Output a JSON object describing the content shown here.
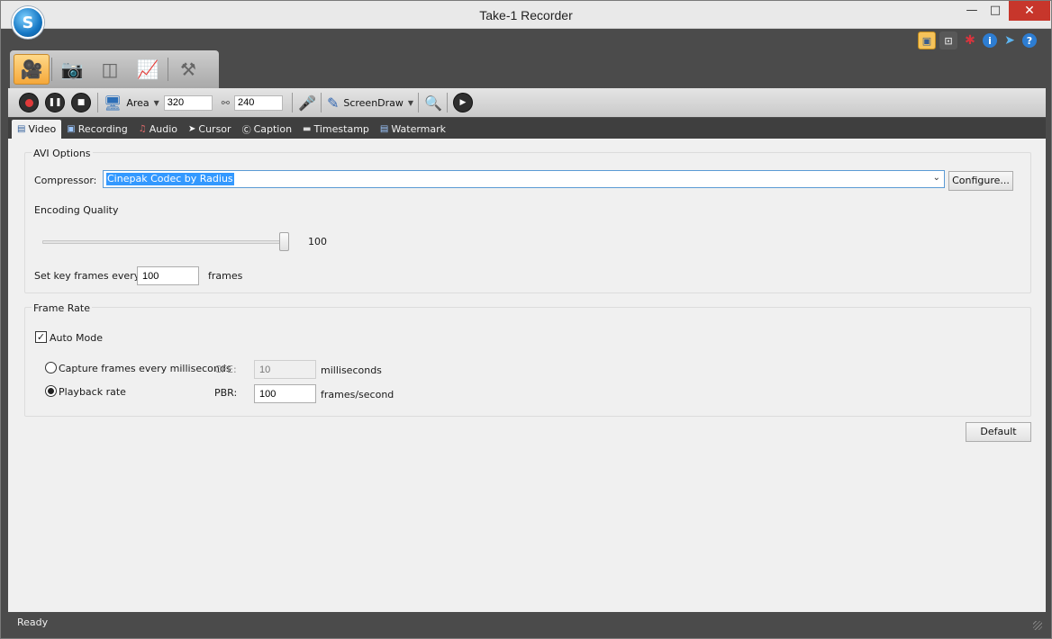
{
  "window": {
    "title": "Take-1 Recorder",
    "minimize_icon": "minimize-icon",
    "maximize_icon": "maximize-icon",
    "close_icon": "close-icon"
  },
  "mode_tabs": [
    {
      "icon": "video-camera-icon",
      "active": true
    },
    {
      "icon": "photo-camera-icon",
      "active": false
    },
    {
      "icon": "webcam-icon",
      "active": false
    },
    {
      "icon": "chart-edit-icon",
      "active": false
    },
    {
      "icon": "tools-icon",
      "active": false
    }
  ],
  "toolbar": {
    "area_label": "Area",
    "width_value": "320",
    "height_value": "240",
    "screendraw_label": "ScreenDraw"
  },
  "subtabs": [
    {
      "label": "Video",
      "active": true
    },
    {
      "label": "Recording",
      "active": false
    },
    {
      "label": "Audio",
      "active": false
    },
    {
      "label": "Cursor",
      "active": false
    },
    {
      "label": "Caption",
      "active": false
    },
    {
      "label": "Timestamp",
      "active": false
    },
    {
      "label": "Watermark",
      "active": false
    }
  ],
  "avi": {
    "title": "AVI Options",
    "compressor_label": "Compressor:",
    "compressor_value": "Cinepak Codec by Radius",
    "configure_label": "Configure...",
    "quality_label": "Encoding Quality",
    "quality_value": "100",
    "quality_fraction": 1.0,
    "keyframes_label": "Set key frames every",
    "keyframes_value": "100",
    "keyframes_unit": "frames"
  },
  "frame_rate": {
    "title": "Frame Rate",
    "auto_mode_label": "Auto Mode",
    "auto_mode_checked": true,
    "capture_label": "Capture frames every milliseconds",
    "cfe_label": "CFE:",
    "cfe_value": "10",
    "cfe_unit": "milliseconds",
    "playback_label": "Playback rate",
    "pbr_label": "PBR:",
    "pbr_value": "100",
    "pbr_unit": "frames/second"
  },
  "default_label": "Default",
  "status": "Ready"
}
